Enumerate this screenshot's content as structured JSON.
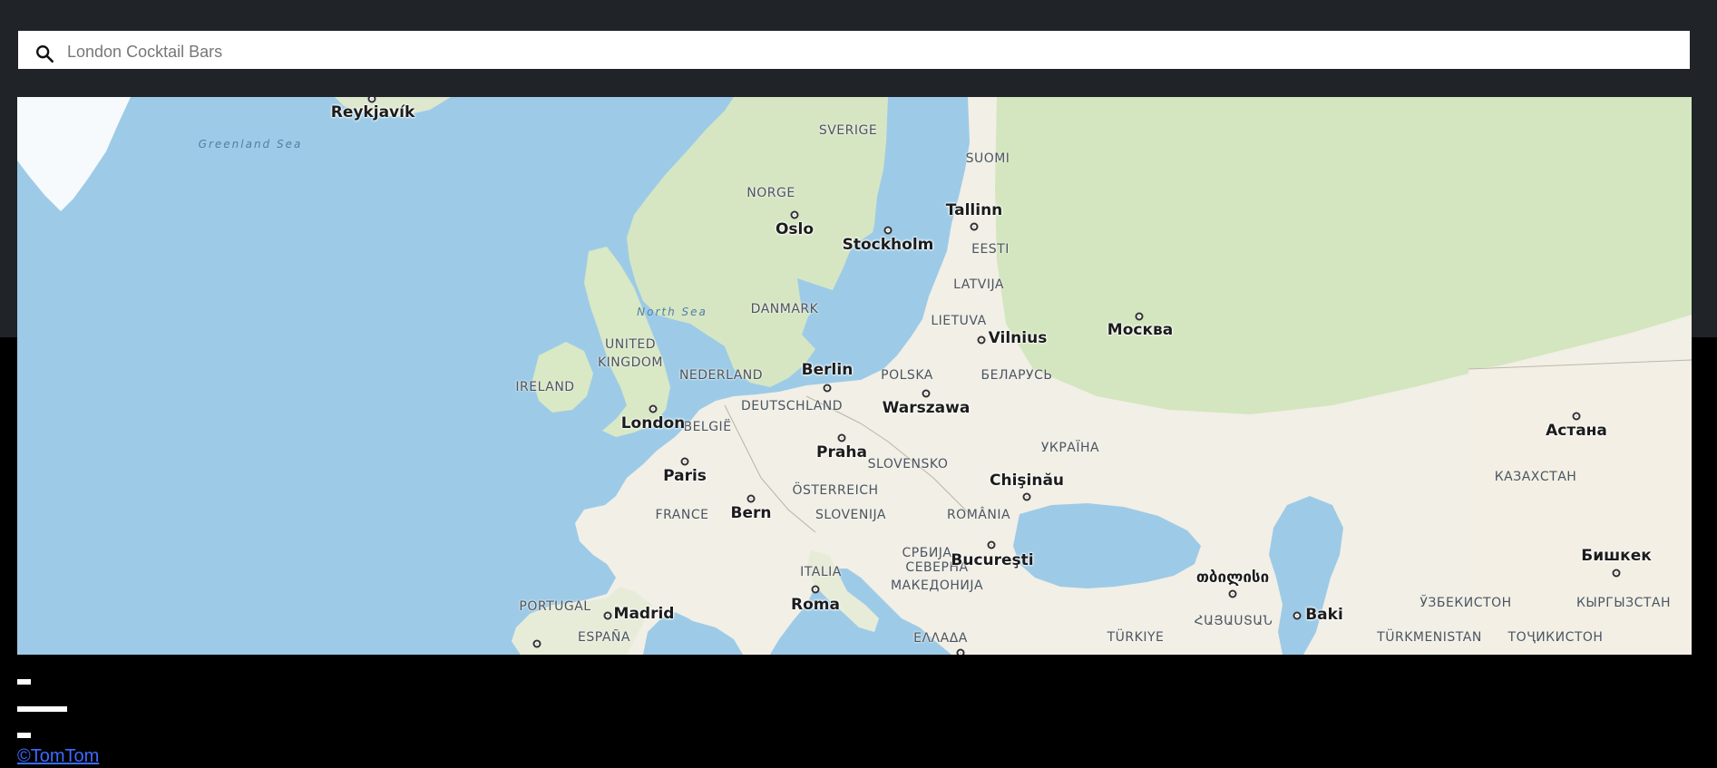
{
  "search": {
    "placeholder": "London Cocktail Bars",
    "icon": "search-icon"
  },
  "map": {
    "cities": [
      {
        "id": "reykjavik",
        "name": "Reykjavík"
      },
      {
        "id": "oslo",
        "name": "Oslo"
      },
      {
        "id": "stockholm",
        "name": "Stockholm"
      },
      {
        "id": "tallinn",
        "name": "Tallinn"
      },
      {
        "id": "moskva",
        "name": "Москва"
      },
      {
        "id": "vilnius",
        "name": "Vilnius"
      },
      {
        "id": "berlin",
        "name": "Berlin"
      },
      {
        "id": "warszawa",
        "name": "Warszawa"
      },
      {
        "id": "london",
        "name": "London"
      },
      {
        "id": "praha",
        "name": "Praha"
      },
      {
        "id": "paris",
        "name": "Paris"
      },
      {
        "id": "chisinau",
        "name": "Chişinău"
      },
      {
        "id": "bern",
        "name": "Bern"
      },
      {
        "id": "bucuresti",
        "name": "Bucureşti"
      },
      {
        "id": "roma",
        "name": "Roma"
      },
      {
        "id": "madrid",
        "name": "Madrid"
      },
      {
        "id": "tbilisi",
        "name": "თბილისი"
      },
      {
        "id": "baki",
        "name": "Baki"
      },
      {
        "id": "astana",
        "name": "Астана"
      },
      {
        "id": "bishkek",
        "name": "Бишкек"
      }
    ],
    "countries": [
      {
        "id": "sverige",
        "name": "SVERIGE"
      },
      {
        "id": "suomi",
        "name": "SUOMI"
      },
      {
        "id": "norge",
        "name": "NORGE"
      },
      {
        "id": "eesti",
        "name": "EESTI"
      },
      {
        "id": "latvija",
        "name": "LATVIJA"
      },
      {
        "id": "danmark",
        "name": "DANMARK"
      },
      {
        "id": "lietuva",
        "name": "LIETUVA"
      },
      {
        "id": "united-kingdom",
        "name": "UNITED\nKINGDOM"
      },
      {
        "id": "ireland",
        "name": "IRELAND"
      },
      {
        "id": "nederland",
        "name": "NEDERLAND"
      },
      {
        "id": "polska",
        "name": "POLSKA"
      },
      {
        "id": "belarus",
        "name": "БЕЛАРУСЬ"
      },
      {
        "id": "belgie",
        "name": "BELGIË"
      },
      {
        "id": "deutschland",
        "name": "DEUTSCHLAND"
      },
      {
        "id": "ukraina",
        "name": "УКРАЇНА"
      },
      {
        "id": "kazakhstan",
        "name": "КАЗАХСТАН"
      },
      {
        "id": "slovensko",
        "name": "SLOVENSKO"
      },
      {
        "id": "osterreich",
        "name": "ÖSTERREICH"
      },
      {
        "id": "france",
        "name": "FRANCE"
      },
      {
        "id": "slovenija",
        "name": "SLOVENIJA"
      },
      {
        "id": "romania",
        "name": "ROMÂNIA"
      },
      {
        "id": "srbija",
        "name": "СРБИЈА"
      },
      {
        "id": "italia",
        "name": "ITALIA"
      },
      {
        "id": "makedonija",
        "name": "СЕВЕРНА\nМАКЕДОНИЈА"
      },
      {
        "id": "portugal",
        "name": "PORTUGAL"
      },
      {
        "id": "espana",
        "name": "ESPAÑA"
      },
      {
        "id": "ellada",
        "name": "ΕΛΛΑΔΑ"
      },
      {
        "id": "turkiye",
        "name": "TÜRKIYE"
      },
      {
        "id": "hayastan",
        "name": "ՀԱՅԱՍՏԱՆ"
      },
      {
        "id": "uzbekistan",
        "name": "ЎЗБЕКИСТОН"
      },
      {
        "id": "kyrgyzstan",
        "name": "КЫРГЫЗСТАН"
      },
      {
        "id": "turkmenistan",
        "name": "TÜRKMENISTAN"
      },
      {
        "id": "tojikiston",
        "name": "ТОҶИКИСТОН"
      }
    ],
    "seas": [
      {
        "id": "greenland-sea",
        "name": "Greenland Sea"
      },
      {
        "id": "north-sea",
        "name": "North Sea"
      }
    ],
    "colors": {
      "water": "#9dcbe7",
      "land": "#f2efe6",
      "forest": "#cfe3bc",
      "ice": "#f6fafc"
    }
  },
  "footer": {
    "attribution": "©TomTom"
  }
}
